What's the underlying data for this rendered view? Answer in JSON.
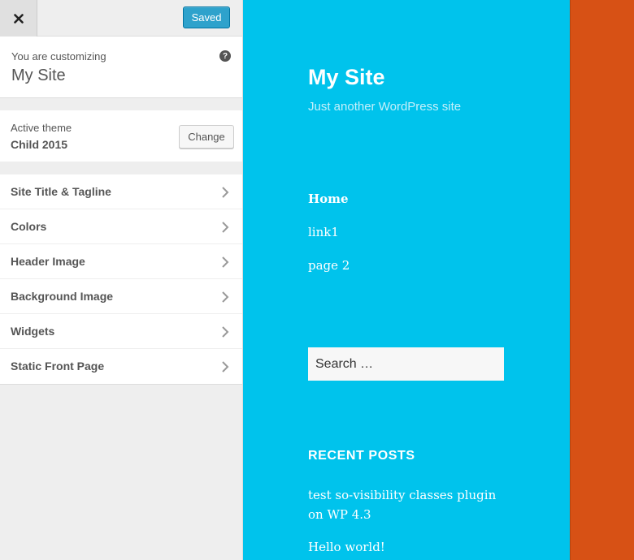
{
  "colors": {
    "preview_background": "#00c3ec",
    "accent_strip": "#d75115",
    "saved_button": "#2ea2cc"
  },
  "customizer": {
    "close_icon": "close-icon",
    "saved_label": "Saved",
    "customizing_label": "You are customizing",
    "site_name": "My Site",
    "help_icon": "?",
    "active_theme_label": "Active theme",
    "theme_name": "Child 2015",
    "change_label": "Change",
    "sections": [
      {
        "label": "Site Title & Tagline"
      },
      {
        "label": "Colors"
      },
      {
        "label": "Header Image"
      },
      {
        "label": "Background Image"
      },
      {
        "label": "Widgets"
      },
      {
        "label": "Static Front Page"
      }
    ]
  },
  "preview": {
    "site_title": "My Site",
    "tagline": "Just another WordPress site",
    "nav": [
      "Home",
      "link1",
      "page 2"
    ],
    "search_placeholder": "Search …",
    "recent_posts_heading": "RECENT POSTS",
    "recent_posts": [
      "test so-visibility classes plugin on WP 4.3",
      "Hello world!"
    ]
  }
}
